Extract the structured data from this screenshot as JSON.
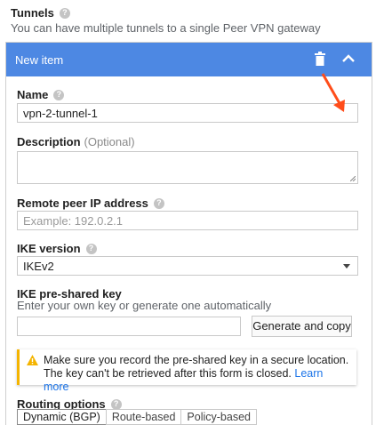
{
  "section": {
    "title": "Tunnels",
    "subtitle": "You can have multiple tunnels to a single Peer VPN gateway"
  },
  "card": {
    "title": "New item",
    "header_color": "#4d88e3"
  },
  "fields": {
    "name_label": "Name",
    "name_value": "vpn-2-tunnel-1",
    "description_label": "Description",
    "description_optional": "(Optional)",
    "peer_ip_label": "Remote peer IP address",
    "peer_ip_placeholder": "Example: 192.0.2.1",
    "ike_version_label": "IKE version",
    "ike_version_value": "IKEv2",
    "psk_label": "IKE pre-shared key",
    "psk_hint": "Enter your own key or generate one automatically",
    "generate_button": "Generate and copy"
  },
  "warning": {
    "line1": "Make sure you record the pre-shared key in a secure location.",
    "line2": "The key can't be retrieved after this form is closed.",
    "link": "Learn more",
    "accent": "#f4b400"
  },
  "routing": {
    "label": "Routing options",
    "tabs": [
      "Dynamic (BGP)",
      "Route-based",
      "Policy-based"
    ],
    "selected": "Dynamic (BGP)"
  },
  "icons": {
    "help": "question-icon",
    "delete": "trash-icon",
    "collapse": "chevron-up-icon",
    "warning": "warning-icon",
    "annotation": "arrow-icon"
  },
  "annotation_color": "#ff4d1a"
}
